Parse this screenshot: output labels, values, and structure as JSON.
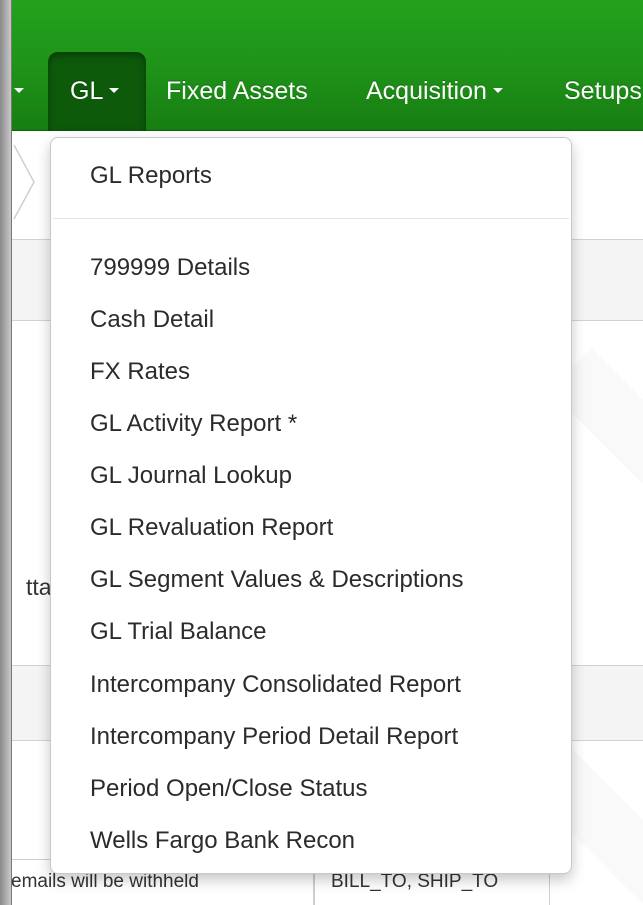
{
  "navbar": {
    "items": [
      {
        "label": "",
        "has_caret": true
      },
      {
        "label": "GL",
        "has_caret": true,
        "active": true
      },
      {
        "label": "Fixed Assets",
        "has_caret": false
      },
      {
        "label": "Acquisition",
        "has_caret": true
      },
      {
        "label": "Setups",
        "has_caret": false
      }
    ]
  },
  "dropdown": {
    "header_item": "GL Reports",
    "items": [
      "799999 Details",
      "Cash Detail",
      "FX Rates",
      "GL Activity Report *",
      "GL Journal Lookup",
      "GL Revaluation Report",
      "GL Segment Values & Descriptions",
      "GL Trial Balance",
      "Intercompany Consolidated Report",
      "Intercompany Period Detail Report",
      "Period Open/Close Status",
      "Wells Fargo Bank Recon"
    ]
  },
  "background": {
    "partial_label": "tta",
    "table_cells": [
      "emails will be withheld",
      "BILL_TO, SHIP_TO"
    ]
  },
  "colors": {
    "navbar_green": "#1e9218",
    "active_tab": "#0c5a0a"
  },
  "icons": {
    "caret": "caret-down-icon",
    "breadcrumb": "chevron-right-icon"
  }
}
